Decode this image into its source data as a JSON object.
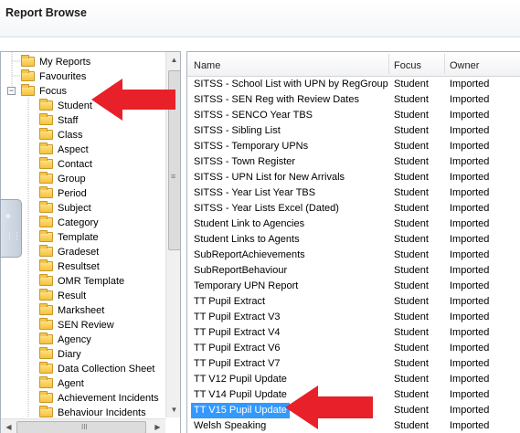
{
  "window": {
    "title": "Report Browse"
  },
  "tree": {
    "items": [
      {
        "label": "My Reports",
        "indent": 0
      },
      {
        "label": "Favourites",
        "indent": 0
      },
      {
        "label": "Focus",
        "indent": 0,
        "expander": "−"
      },
      {
        "label": "Student",
        "indent": 1
      },
      {
        "label": "Staff",
        "indent": 1
      },
      {
        "label": "Class",
        "indent": 1
      },
      {
        "label": "Aspect",
        "indent": 1
      },
      {
        "label": "Contact",
        "indent": 1
      },
      {
        "label": "Group",
        "indent": 1
      },
      {
        "label": "Period",
        "indent": 1
      },
      {
        "label": "Subject",
        "indent": 1
      },
      {
        "label": "Category",
        "indent": 1
      },
      {
        "label": "Template",
        "indent": 1
      },
      {
        "label": "Gradeset",
        "indent": 1
      },
      {
        "label": "Resultset",
        "indent": 1
      },
      {
        "label": "OMR Template",
        "indent": 1
      },
      {
        "label": "Result",
        "indent": 1
      },
      {
        "label": "Marksheet",
        "indent": 1
      },
      {
        "label": "SEN Review",
        "indent": 1
      },
      {
        "label": "Agency",
        "indent": 1
      },
      {
        "label": "Diary",
        "indent": 1
      },
      {
        "label": "Data Collection Sheet",
        "indent": 1
      },
      {
        "label": "Agent",
        "indent": 1
      },
      {
        "label": "Achievement Incidents",
        "indent": 1
      },
      {
        "label": "Behaviour Incidents",
        "indent": 1
      }
    ]
  },
  "list": {
    "columns": [
      "Name",
      "Focus",
      "Owner"
    ],
    "rows": [
      {
        "name": "SITSS - School List with UPN by RegGroup",
        "focus": "Student",
        "owner": "Imported"
      },
      {
        "name": "SITSS - SEN Reg with Review Dates",
        "focus": "Student",
        "owner": "Imported"
      },
      {
        "name": "SITSS - SENCO Year TBS",
        "focus": "Student",
        "owner": "Imported"
      },
      {
        "name": "SITSS - Sibling List",
        "focus": "Student",
        "owner": "Imported"
      },
      {
        "name": "SITSS - Temporary UPNs",
        "focus": "Student",
        "owner": "Imported"
      },
      {
        "name": "SITSS - Town Register",
        "focus": "Student",
        "owner": "Imported"
      },
      {
        "name": "SITSS - UPN List for New Arrivals",
        "focus": "Student",
        "owner": "Imported"
      },
      {
        "name": "SITSS - Year List Year TBS",
        "focus": "Student",
        "owner": "Imported"
      },
      {
        "name": "SITSS - Year Lists Excel (Dated)",
        "focus": "Student",
        "owner": "Imported"
      },
      {
        "name": "Student Link to Agencies",
        "focus": "Student",
        "owner": "Imported"
      },
      {
        "name": "Student Links to Agents",
        "focus": "Student",
        "owner": "Imported"
      },
      {
        "name": "SubReportAchievements",
        "focus": "Student",
        "owner": "Imported"
      },
      {
        "name": "SubReportBehaviour",
        "focus": "Student",
        "owner": "Imported"
      },
      {
        "name": "Temporary UPN Report",
        "focus": "Student",
        "owner": "Imported"
      },
      {
        "name": "TT Pupil Extract",
        "focus": "Student",
        "owner": "Imported"
      },
      {
        "name": "TT Pupil Extract V3",
        "focus": "Student",
        "owner": "Imported"
      },
      {
        "name": "TT Pupil Extract V4",
        "focus": "Student",
        "owner": "Imported"
      },
      {
        "name": "TT Pupil Extract V6",
        "focus": "Student",
        "owner": "Imported"
      },
      {
        "name": "TT Pupil Extract V7",
        "focus": "Student",
        "owner": "Imported"
      },
      {
        "name": "TT V12 Pupil Update",
        "focus": "Student",
        "owner": "Imported"
      },
      {
        "name": "TT V14 Pupil Update",
        "focus": "Student",
        "owner": "Imported"
      },
      {
        "name": "TT V15 Pupil Update",
        "focus": "Student",
        "owner": "Imported",
        "selected": true
      },
      {
        "name": "Welsh Speaking",
        "focus": "Student",
        "owner": "Imported"
      }
    ]
  },
  "colors": {
    "selection": "#3399ff",
    "annotation_arrow": "#e8202a",
    "folder": "#f5c23b"
  },
  "icons": {
    "tree_item": "folder-icon",
    "splitter": "expand-panel-icon"
  }
}
